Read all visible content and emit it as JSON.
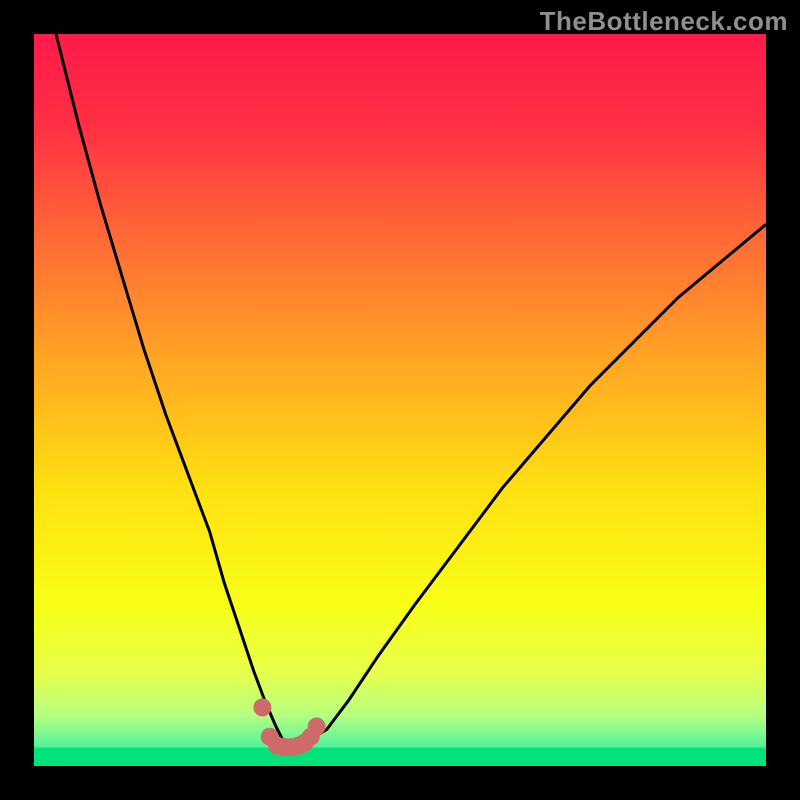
{
  "watermark": "TheBottleneck.com",
  "colors": {
    "frame": "#000000",
    "curve": "#000000",
    "marker": "#cf6a6a",
    "flat_band": "#00e27a"
  },
  "chart_data": {
    "type": "line",
    "title": "",
    "xlabel": "",
    "ylabel": "",
    "xlim": [
      0,
      100
    ],
    "ylim": [
      0,
      100
    ],
    "gradient_stops": [
      {
        "offset": 0.0,
        "color": "#ff1b49"
      },
      {
        "offset": 0.12,
        "color": "#ff2e44"
      },
      {
        "offset": 0.28,
        "color": "#ff6a36"
      },
      {
        "offset": 0.45,
        "color": "#ffa723"
      },
      {
        "offset": 0.62,
        "color": "#ffe011"
      },
      {
        "offset": 0.78,
        "color": "#f7ff16"
      },
      {
        "offset": 0.87,
        "color": "#e8ff4a"
      },
      {
        "offset": 0.93,
        "color": "#b7ff80"
      },
      {
        "offset": 0.97,
        "color": "#5bf49a"
      },
      {
        "offset": 1.0,
        "color": "#00e27a"
      }
    ],
    "series": [
      {
        "name": "bottleneck-curve",
        "x": [
          3,
          6,
          9,
          12,
          15,
          18,
          21,
          24,
          26,
          28,
          30,
          31.5,
          33,
          34,
          35,
          36,
          37.5,
          40,
          43,
          47,
          52,
          58,
          64,
          70,
          76,
          82,
          88,
          94,
          100
        ],
        "y": [
          100,
          88,
          77,
          67,
          57,
          48,
          40,
          32,
          25,
          19,
          13,
          9,
          5.5,
          3.5,
          3,
          3,
          3.5,
          5,
          9,
          15,
          22,
          30,
          38,
          45,
          52,
          58,
          64,
          69,
          74
        ]
      }
    ],
    "markers": {
      "name": "optimal-range",
      "x": [
        31.2,
        32.2,
        33.2,
        34.2,
        35.2,
        36.2,
        37.0,
        37.8,
        38.6
      ],
      "y": [
        8.0,
        4.0,
        2.8,
        2.6,
        2.6,
        2.8,
        3.2,
        4.0,
        5.4
      ],
      "radius": 9
    }
  }
}
